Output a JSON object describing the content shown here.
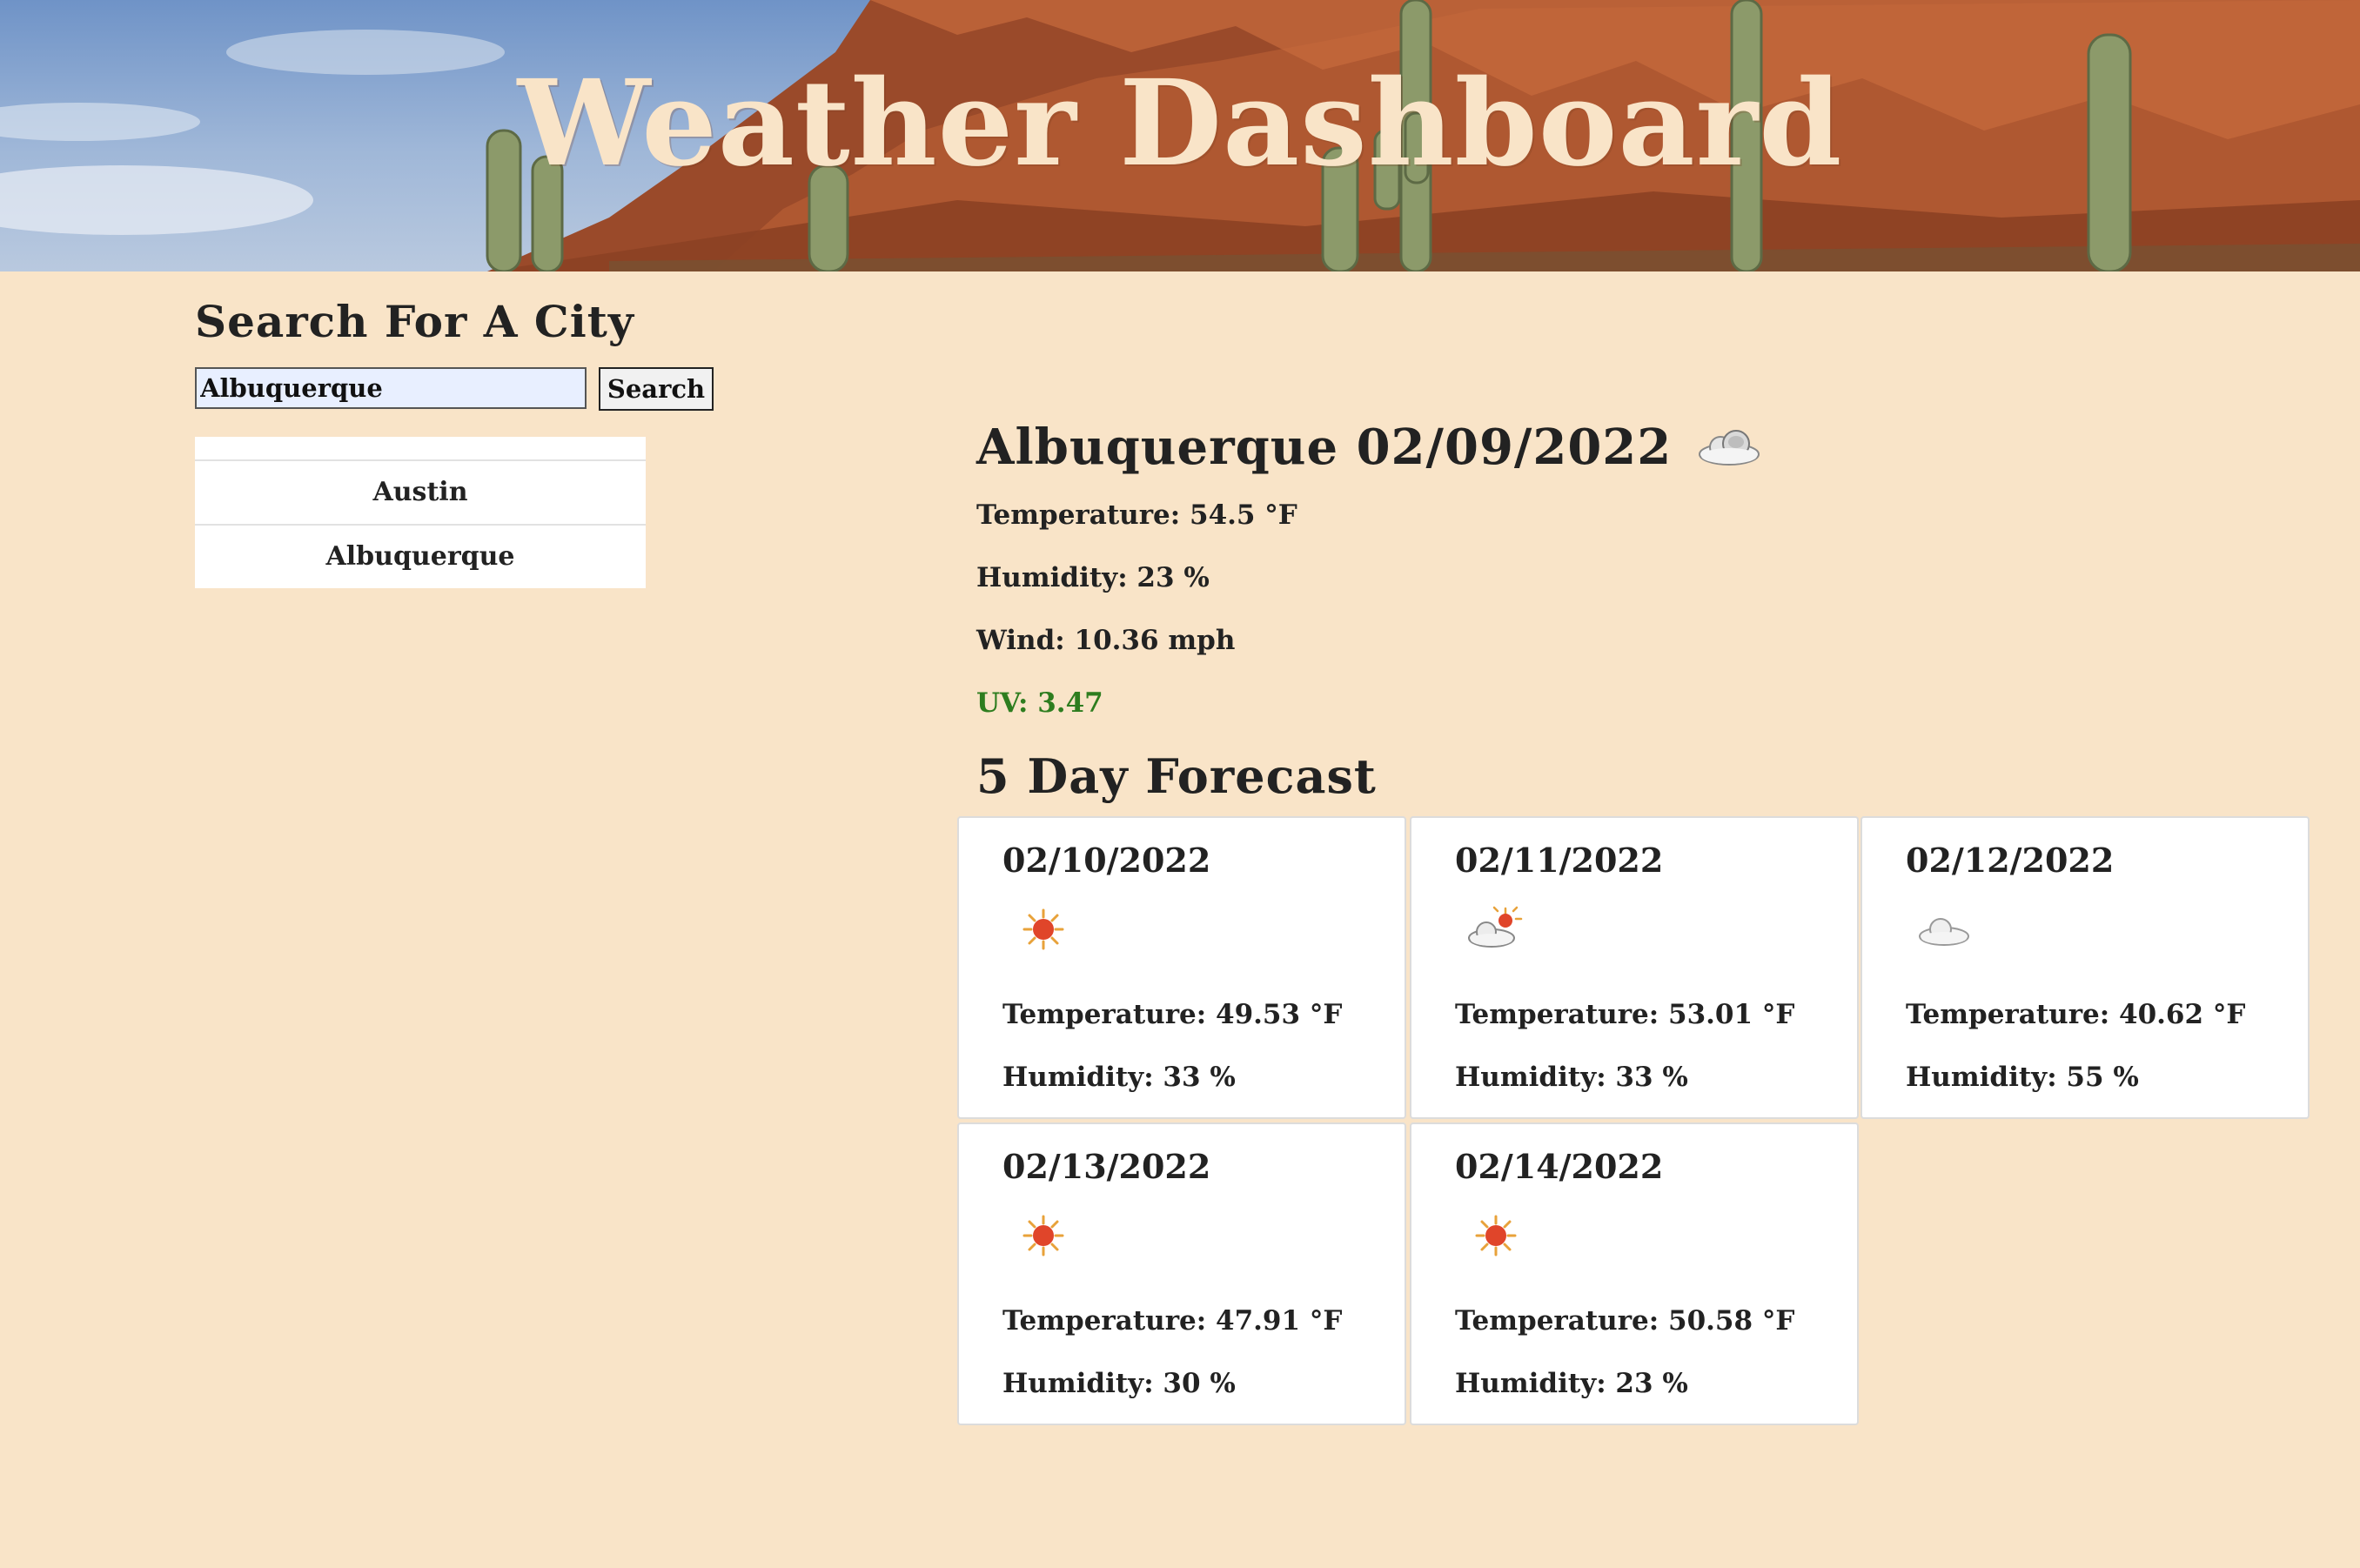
{
  "header": {
    "title": "Weather Dashboard"
  },
  "search": {
    "heading": "Search For A City",
    "input_value": "Albuquerque",
    "button_label": "Search",
    "history": [
      "Austin",
      "Albuquerque"
    ]
  },
  "current": {
    "title": "Albuquerque 02/09/2022",
    "icon": "cloud-icon",
    "temperature": "Temperature: 54.5 °F",
    "humidity": "Humidity: 23 %",
    "wind": "Wind: 10.36 mph",
    "uv": "UV: 3.47",
    "uv_color": "#2e7d1f"
  },
  "forecast": {
    "heading": "5 Day Forecast",
    "days": [
      {
        "date": "02/10/2022",
        "icon": "sun-icon",
        "temperature": "Temperature: 49.53 °F",
        "humidity": "Humidity: 33 %"
      },
      {
        "date": "02/11/2022",
        "icon": "partly-cloudy-icon",
        "temperature": "Temperature: 53.01 °F",
        "humidity": "Humidity: 33 %"
      },
      {
        "date": "02/12/2022",
        "icon": "cloud-icon",
        "temperature": "Temperature: 40.62 °F",
        "humidity": "Humidity: 55 %"
      },
      {
        "date": "02/13/2022",
        "icon": "sun-icon",
        "temperature": "Temperature: 47.91 °F",
        "humidity": "Humidity: 30 %"
      },
      {
        "date": "02/14/2022",
        "icon": "sun-icon",
        "temperature": "Temperature: 50.58 °F",
        "humidity": "Humidity: 23 %"
      }
    ]
  },
  "colors": {
    "page_background": "#f9e4c8",
    "title_color": "#f9e4c8",
    "text": "#222222"
  }
}
